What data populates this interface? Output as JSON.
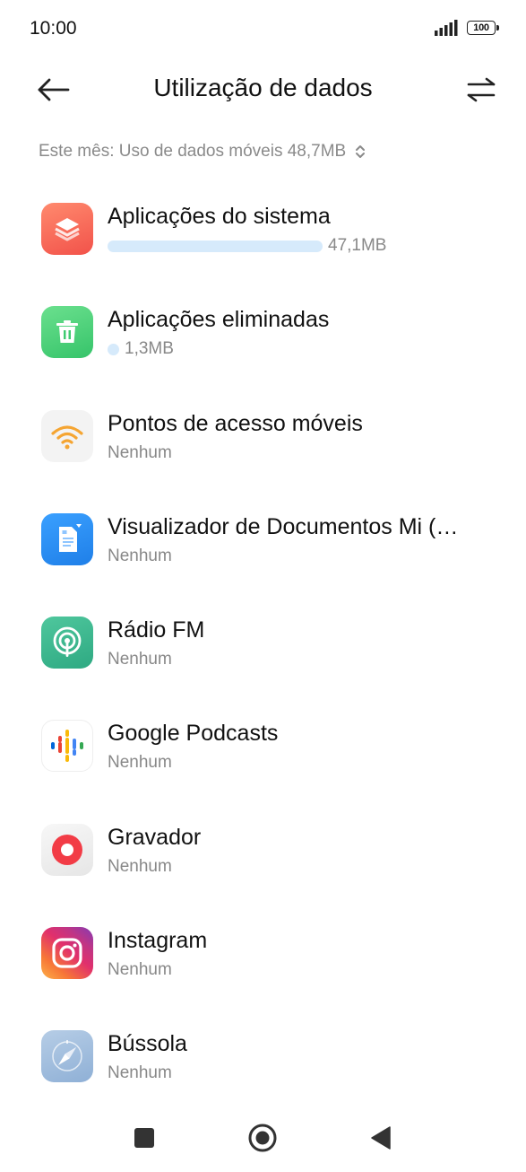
{
  "status_bar": {
    "time": "10:00",
    "battery": "100"
  },
  "header": {
    "title": "Utilização de dados",
    "back_icon": "arrow-left-icon",
    "swap_icon": "swap-arrows-icon"
  },
  "month_selector": {
    "label": "Este mês: Uso de dados móveis 48,7MB"
  },
  "apps": [
    {
      "name": "Aplicações do sistema",
      "usage": "47,1MB",
      "icon": "system-apps-icon"
    },
    {
      "name": "Aplicações eliminadas",
      "usage": "1,3MB",
      "icon": "trash-icon"
    },
    {
      "name": "Pontos de acesso móveis",
      "usage": "Nenhum",
      "icon": "hotspot-icon"
    },
    {
      "name": "Visualizador de Documentos Mi (…",
      "usage": "Nenhum",
      "icon": "document-icon"
    },
    {
      "name": "Rádio FM",
      "usage": "Nenhum",
      "icon": "radio-icon"
    },
    {
      "name": "Google Podcasts",
      "usage": "Nenhum",
      "icon": "podcasts-icon"
    },
    {
      "name": "Gravador",
      "usage": "Nenhum",
      "icon": "recorder-icon"
    },
    {
      "name": "Instagram",
      "usage": "Nenhum",
      "icon": "instagram-icon"
    },
    {
      "name": "Bússola",
      "usage": "Nenhum",
      "icon": "compass-icon"
    }
  ],
  "colors": {
    "usage_bar": "#d6eafb",
    "secondary_text": "#888888"
  }
}
